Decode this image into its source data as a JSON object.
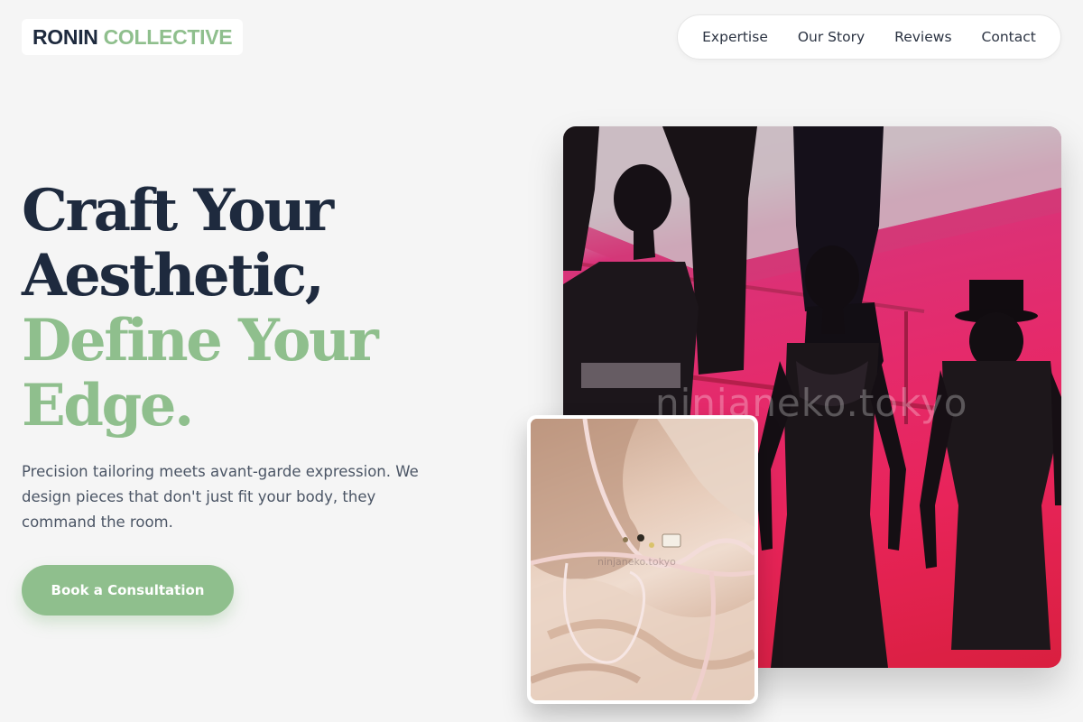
{
  "brand": {
    "word1": "RONIN",
    "word2": "COLLECTIVE",
    "primary_color": "#1e2a3e",
    "accent_color": "#8fbf8d"
  },
  "nav": {
    "items": [
      {
        "label": "Expertise"
      },
      {
        "label": "Our Story"
      },
      {
        "label": "Reviews"
      },
      {
        "label": "Contact"
      }
    ]
  },
  "hero": {
    "headline_line1": "Craft Your",
    "headline_line2": "Aesthetic,",
    "headline_line3": "Define Your",
    "headline_line4": "Edge.",
    "lead": "Precision tailoring meets avant-garde expression. We design pieces that don't just fit your body, they command the room.",
    "cta_label": "Book a Consultation"
  },
  "images": {
    "main_watermark": "ninjaneko.tokyo",
    "detail_watermark": "ninjaneko.tokyo"
  }
}
